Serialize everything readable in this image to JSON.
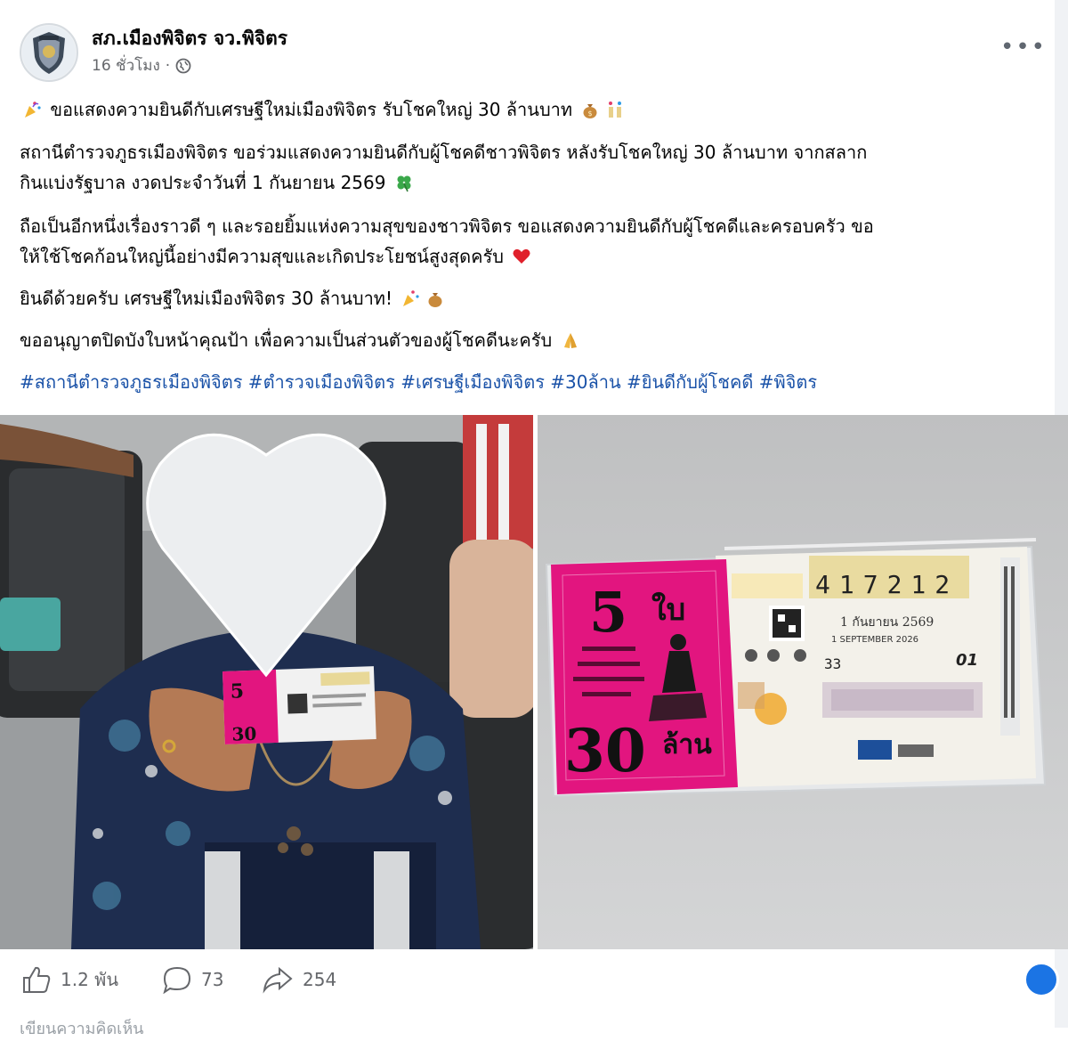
{
  "post": {
    "page_name": "สภ.เมืองพิจิตร จว.พิจิตร",
    "timestamp": "16 ชั่วโมง",
    "audience_icon": "globe-icon",
    "more_icon": "more-options-icon",
    "headline": "ขอแสดงความยินดีกับเศรษฐีใหม่เมืองพิจิตร รับโชคใหญ่ 30 ล้านบาท",
    "paragraph1_line1": "สถานีตำรวจภูธรเมืองพิจิตร ขอร่วมแสดงความยินดีกับผู้โชคดีชาวพิจิตร หลังรับโชคใหญ่ 30 ล้านบาท จากสลาก",
    "paragraph1_line2": "กินแบ่งรัฐบาล งวดประจำวันที่ 1 กันยายน 2569",
    "paragraph2_line1": "ถือเป็นอีกหนึ่งเรื่องราวดี ๆ และรอยยิ้มแห่งความสุขของชาวพิจิตร ขอแสดงความยินดีกับผู้โชคดีและครอบครัว ขอ",
    "paragraph2_line2": "ให้ใช้โชคก้อนใหญ่นี้อย่างมีความสุขและเกิดประโยชน์สูงสุดครับ",
    "congrats": "ยินดีด้วยครับ เศรษฐีใหม่เมืองพิจิตร 30 ล้านบาท!",
    "privacy_note": "ขออนุญาตปิดบังใบหน้าคุณป้า เพื่อความเป็นส่วนตัวของผู้โชคดีนะครับ",
    "hashtags": "#สถานีตำรวจภูธรเมืองพิจิตร #ตำรวจเมืองพิจิตร #เศรษฐีเมืองพิจิตร #30ล้าน #ยินดีกับผู้โชคดี #พิจิตร"
  },
  "ticket": {
    "count_label": "5",
    "count_unit": "ใบ",
    "prize_amount": "30",
    "prize_unit": "ล้าน",
    "ticket_number": "417212",
    "draw_date_th": "1 กันยายน 2569",
    "draw_date_en": "1 SEPTEMBER 2026",
    "set_number": "33",
    "period_number": "01"
  },
  "actions": {
    "likes": "1.2 พัน",
    "comments": "73",
    "shares": "254"
  },
  "footer": {
    "cut_text": "เขียนความคิดเห็น"
  },
  "colors": {
    "hashtag": "#1a52a8",
    "ticket_pink": "#e2157f",
    "fb_blue": "#1b74e4",
    "muted": "#65676b"
  }
}
